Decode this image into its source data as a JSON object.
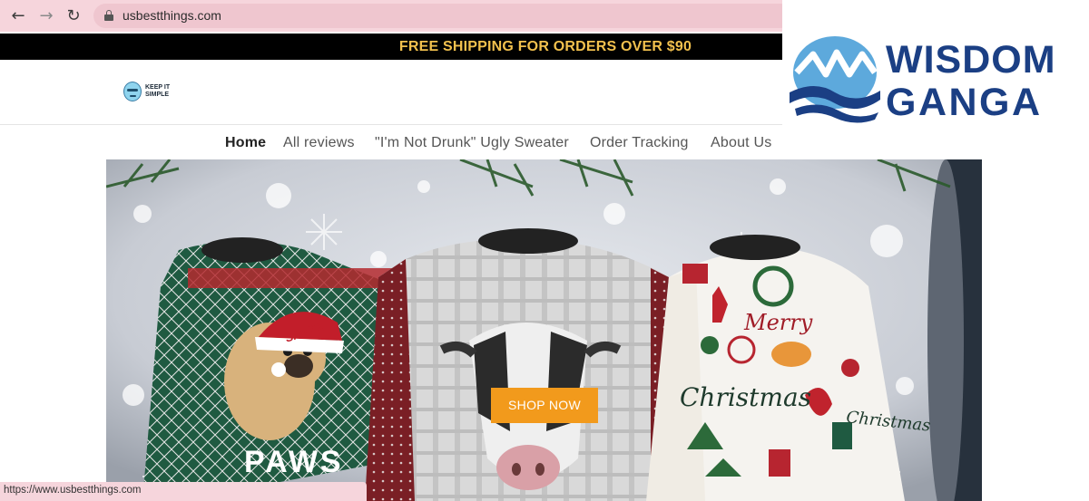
{
  "browser": {
    "url": "usbestthings.com",
    "status_url": "https://www.usbestthings.com"
  },
  "announcement": {
    "text": "FREE SHIPPING FOR ORDERS OVER $90",
    "text_color": "#f2c14e"
  },
  "site": {
    "logo_text": "KEEP IT SIMPLE"
  },
  "nav": {
    "items": [
      {
        "label": "Home",
        "active": true
      },
      {
        "label": "All reviews"
      },
      {
        "label": "\"I'm Not Drunk\" Ugly Sweater"
      },
      {
        "label": "Order Tracking"
      },
      {
        "label": "About Us"
      }
    ]
  },
  "hero": {
    "button_label": "SHOP NOW",
    "button_color": "#f29a1c",
    "image_text": {
      "santa": "SANTA",
      "paws": "PAWS",
      "merry": "Merry",
      "christmas": "Christmas",
      "christmas_side": "Christmas"
    }
  },
  "watermark": {
    "line1": "WISDOM",
    "line2": "GANGA",
    "color": "#1b3f84"
  }
}
